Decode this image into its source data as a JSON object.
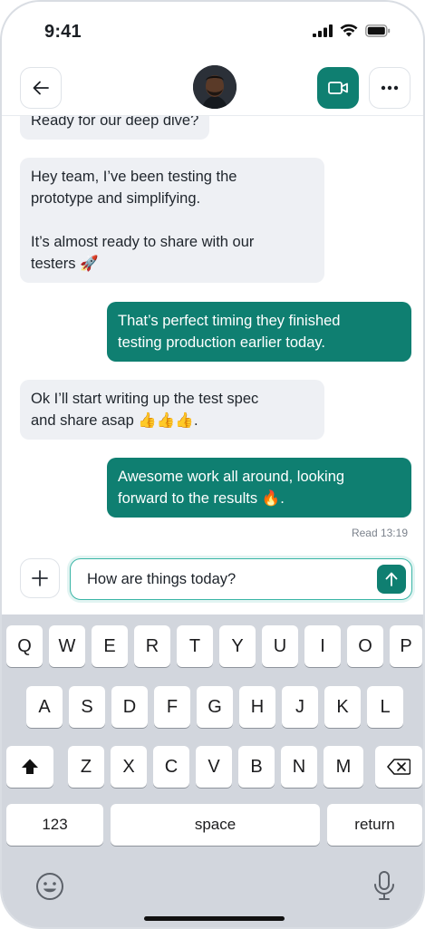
{
  "status": {
    "time": "9:41"
  },
  "header": {
    "back_icon": "arrow-left-icon",
    "video_icon": "video-camera-icon",
    "more_icon": "ellipsis-icon",
    "accent": "#0f7f71"
  },
  "messages": [
    {
      "direction": "in",
      "text": "Ready for our deep dive?"
    },
    {
      "direction": "in",
      "text": "Hey team, I’ve been testing the\nprototype and simplifying.\n\nIt’s almost ready to share with our\ntesters 🚀"
    },
    {
      "direction": "out",
      "text": "That’s perfect timing they finished\ntesting production earlier today."
    },
    {
      "direction": "in",
      "text": "Ok I’ll start writing up the test spec\nand share asap 👍👍👍."
    },
    {
      "direction": "out",
      "text": "Awesome work all around, looking\nforward to the results 🔥."
    }
  ],
  "read_receipt": "Read 13:19",
  "composer": {
    "value": "How are things today?",
    "add_icon": "plus-icon",
    "send_icon": "arrow-up-icon"
  },
  "keyboard": {
    "row1": [
      "Q",
      "W",
      "E",
      "R",
      "T",
      "Y",
      "U",
      "I",
      "O",
      "P"
    ],
    "row2": [
      "A",
      "S",
      "D",
      "F",
      "G",
      "H",
      "J",
      "K",
      "L"
    ],
    "row3": [
      "Z",
      "X",
      "C",
      "V",
      "B",
      "N",
      "M"
    ],
    "numbers_label": "123",
    "space_label": "space",
    "return_label": "return",
    "shift_icon": "shift-icon",
    "backspace_icon": "backspace-icon",
    "emoji_icon": "emoji-icon",
    "mic_icon": "microphone-icon"
  }
}
